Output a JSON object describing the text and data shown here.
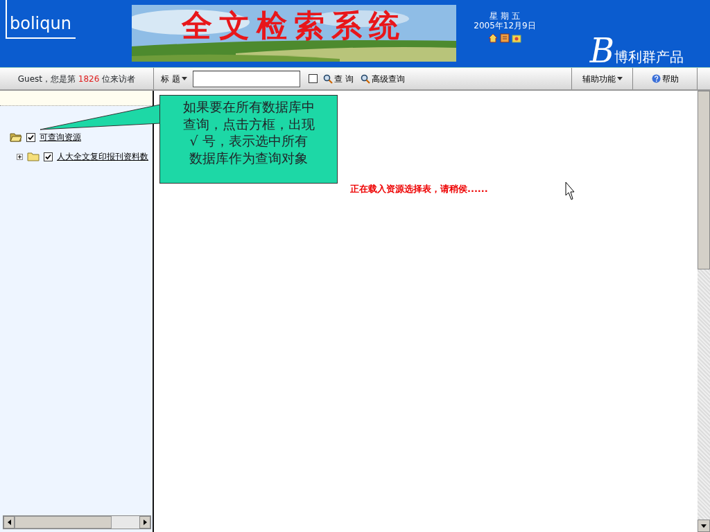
{
  "header": {
    "logo": "boliqun",
    "banner": {
      "title": "全文检索系统"
    },
    "weekday": "星 期 五",
    "date": "2005年12月9日",
    "brand": {
      "mark": "B",
      "name": "博利群产品"
    }
  },
  "toolbar": {
    "visitor": {
      "prefix": "Guest，您是第",
      "count": "1826",
      "suffix": "位来访者"
    },
    "field_select": "标 题",
    "title_checkbox": {
      "checked": false
    },
    "query_button": "查 询",
    "advanced_button": "高级查询",
    "tools_menu": "辅助功能",
    "help_button": "帮助"
  },
  "tree": [
    {
      "label": "可查询资源",
      "checked": true,
      "expanded": true,
      "children": [
        {
          "label": "人大全文复印报刊资料数",
          "checked": true,
          "expanded": false
        }
      ]
    }
  ],
  "callout": {
    "lines": [
      "如果要在所有数据库中",
      "查询，点击方框，出现",
      "√ 号，表示选中所有",
      "数据库作为查询对象"
    ]
  },
  "loading_message": "正在载入资源选择表，请稍侯......"
}
